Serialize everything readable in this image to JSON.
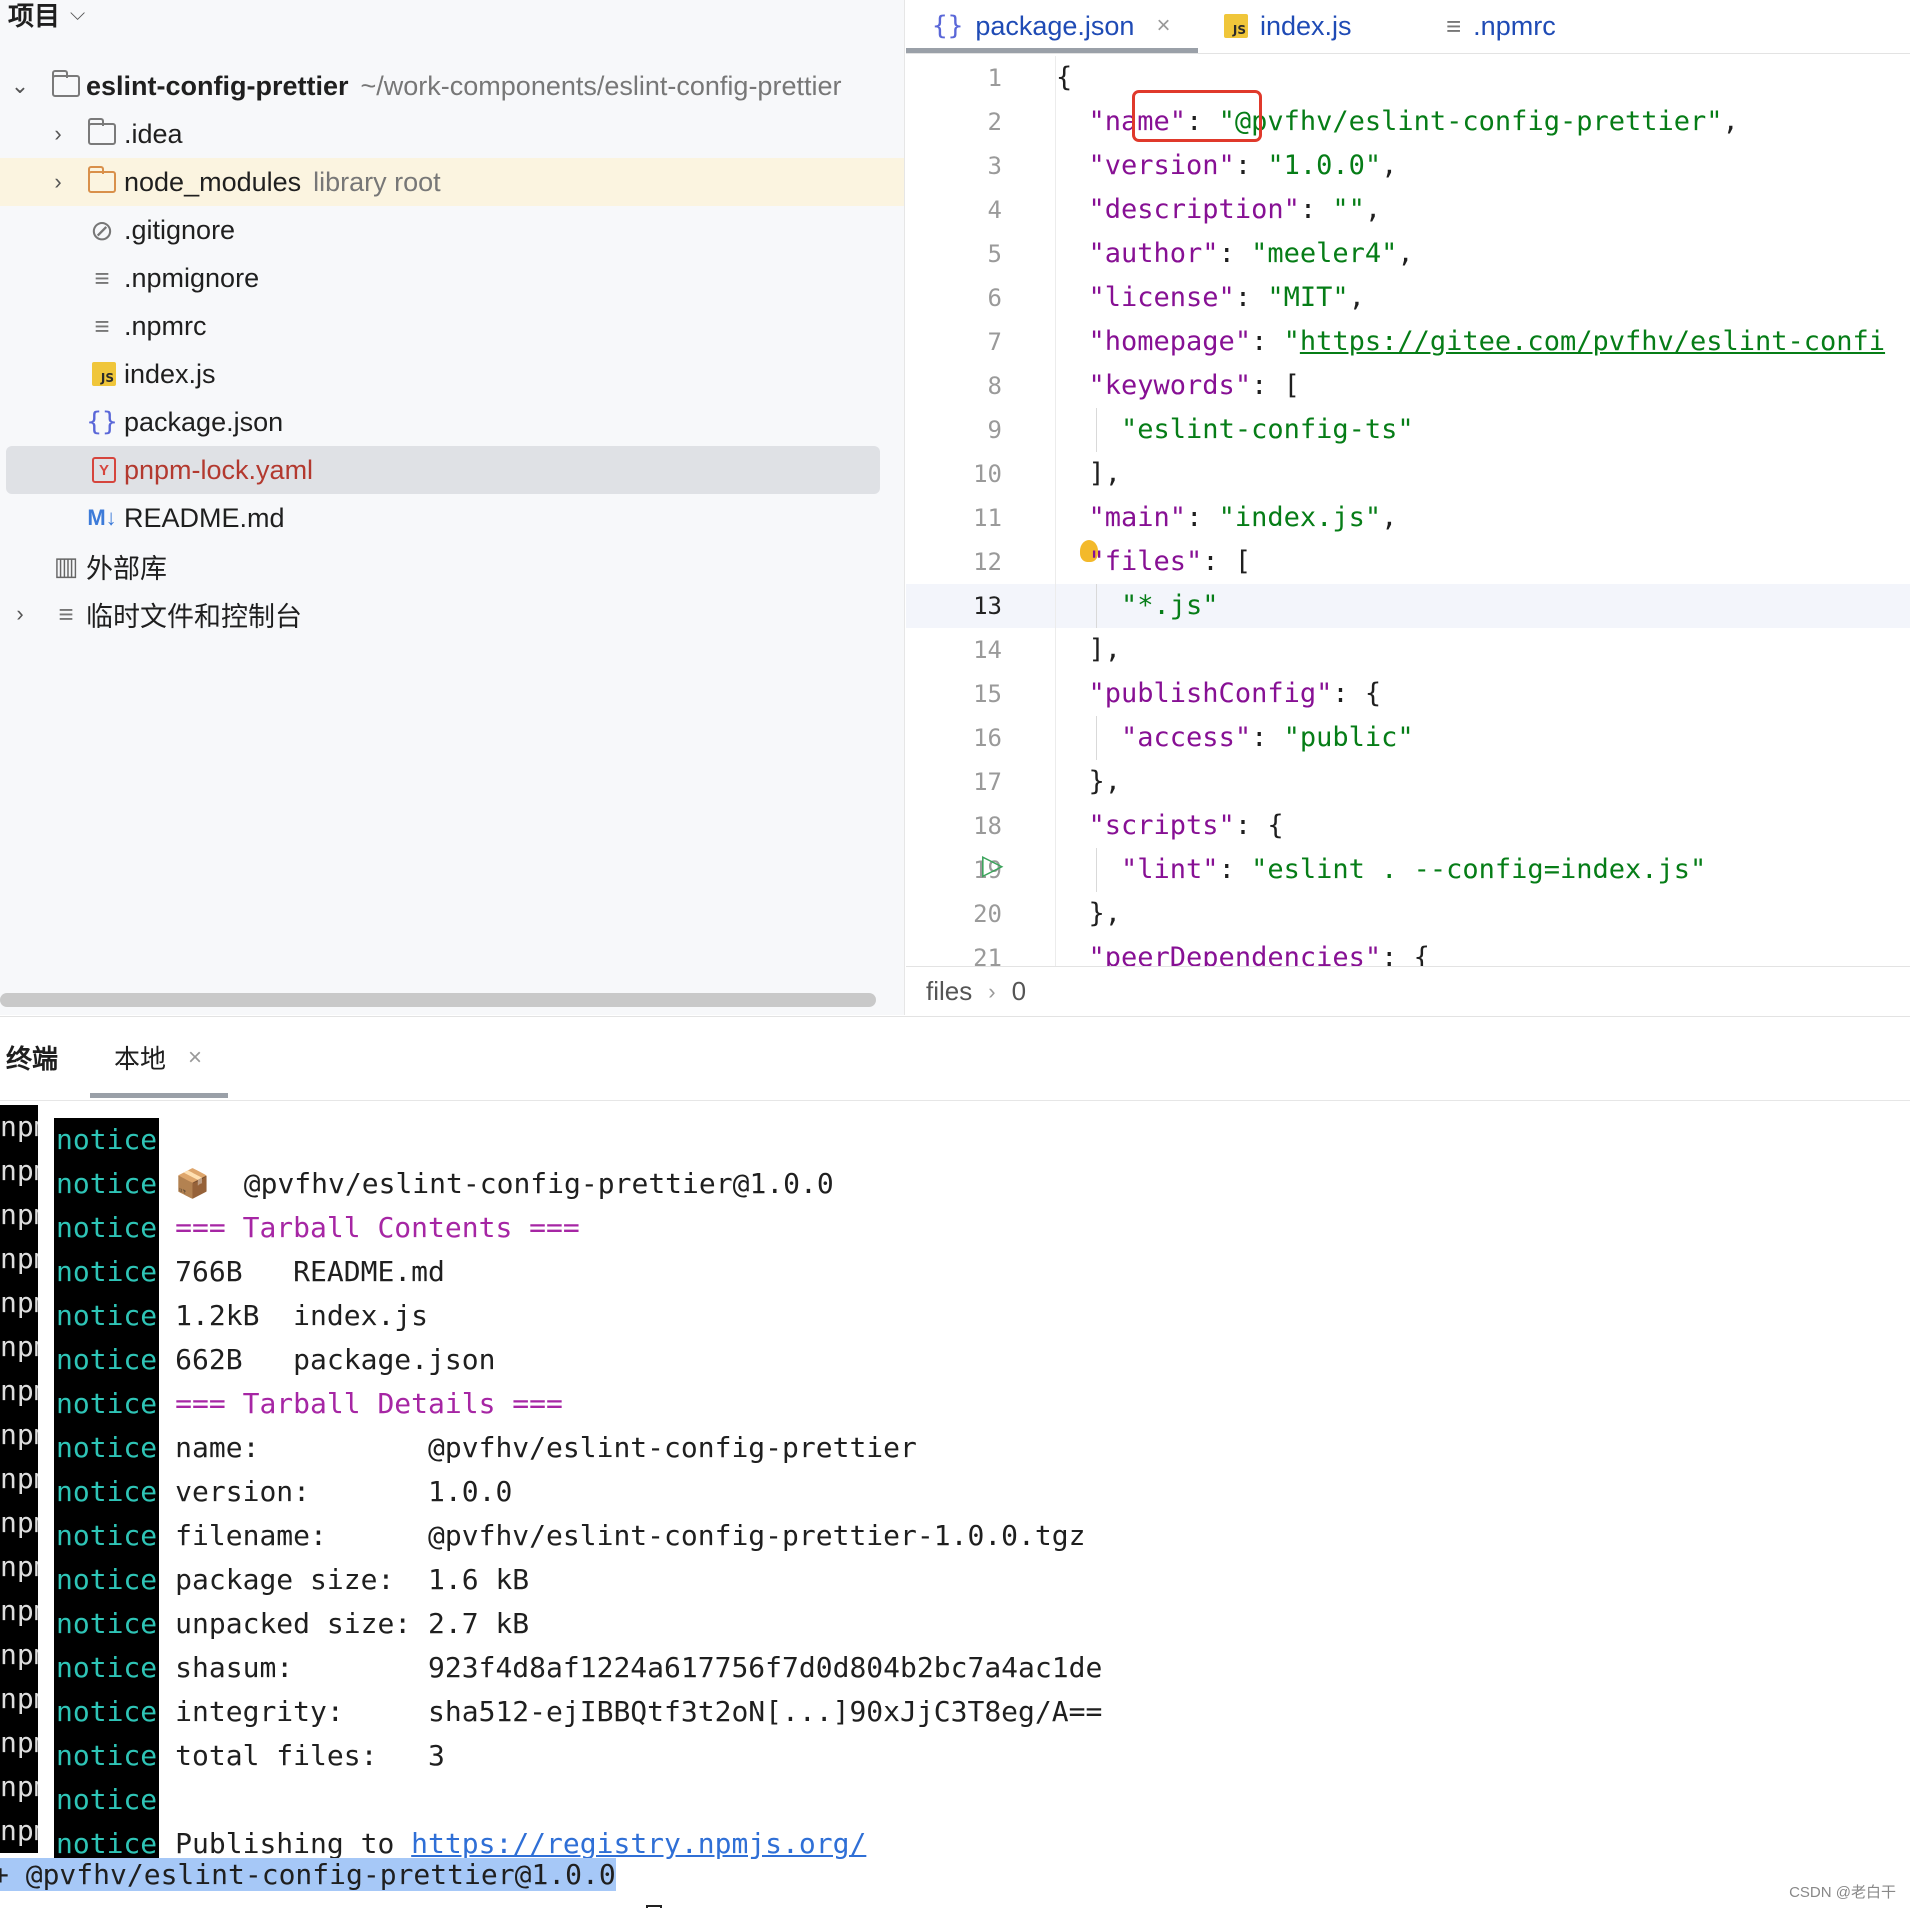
{
  "project": {
    "header": "项目",
    "root": {
      "name": "eslint-config-prettier",
      "path": "~/work-components/eslint-config-prettier"
    },
    "items": [
      {
        "label": ".idea",
        "hint": ""
      },
      {
        "label": "node_modules",
        "hint": "library root"
      },
      {
        "label": ".gitignore",
        "hint": ""
      },
      {
        "label": ".npmignore",
        "hint": ""
      },
      {
        "label": ".npmrc",
        "hint": ""
      },
      {
        "label": "index.js",
        "hint": ""
      },
      {
        "label": "package.json",
        "hint": ""
      },
      {
        "label": "pnpm-lock.yaml",
        "hint": ""
      },
      {
        "label": "README.md",
        "hint": ""
      }
    ],
    "external_libs": "外部库",
    "scratches": "临时文件和控制台"
  },
  "editor": {
    "tabs": [
      {
        "label": "package.json",
        "icon": "braces-icon",
        "active": true
      },
      {
        "label": "index.js",
        "icon": "js-icon",
        "active": false
      },
      {
        "label": ".npmrc",
        "icon": "lines-icon",
        "active": false
      }
    ],
    "line_numbers": [
      "1",
      "2",
      "3",
      "4",
      "5",
      "6",
      "7",
      "8",
      "9",
      "10",
      "11",
      "12",
      "13",
      "14",
      "15",
      "16",
      "17",
      "18",
      "19",
      "20",
      "21"
    ],
    "current_line": 13,
    "code": {
      "l2k": "\"name\"",
      "l2v1": "\"@pvfhv",
      "l2v2": "/eslint-config-prettier\"",
      "l3k": "\"version\"",
      "l3v": "\"1.0.0\"",
      "l4k": "\"description\"",
      "l4v": "\"\"",
      "l5k": "\"author\"",
      "l5v": "\"meeler4\"",
      "l6k": "\"license\"",
      "l6v": "\"MIT\"",
      "l7k": "\"homepage\"",
      "l7q": "\"",
      "l7v": "https://gitee.com/pvfhv/eslint-confi",
      "l8k": "\"keywords\"",
      "l9v": "\"eslint-config-ts\"",
      "l11k": "\"main\"",
      "l11v": "\"index.js\"",
      "l12k": "\"files\"",
      "l13v": "\"*.js\"",
      "l15k": "\"publishConfig\"",
      "l16k": "\"access\"",
      "l16v": "\"public\"",
      "l18k": "\"scripts\"",
      "l19k": "\"lint\"",
      "l19v": "\"eslint . --config=index.js\"",
      "l21k": "\"peerDependencies\""
    },
    "breadcrumb": [
      "files",
      "0"
    ]
  },
  "terminal": {
    "title": "终端",
    "tab": "本地",
    "prefix_npm": "npm",
    "prefix_notice": "notice",
    "lines": [
      "",
      "📦  @pvfhv/eslint-config-prettier@1.0.0",
      "=== Tarball Contents ===",
      "766B   README.md",
      "1.2kB  index.js",
      "662B   package.json",
      "=== Tarball Details ===",
      "name:          @pvfhv/eslint-config-prettier",
      "version:       1.0.0",
      "filename:      @pvfhv/eslint-config-prettier-1.0.0.tgz",
      "package size:  1.6 kB",
      "unpacked size: 2.7 kB",
      "shasum:        923f4d8af1224a617756f7d0d804b2bc7a4ac1de",
      "integrity:     sha512-ejIBBQtf3t2oN[...]90xJjC3T8eg/A==",
      "total files:   3",
      "",
      "Publishing to "
    ],
    "publish_url": "https://registry.npmjs.org/",
    "result": "+ @pvfhv/eslint-config-prettier@1.0.0",
    "watermark": "CSDN @老白干"
  }
}
